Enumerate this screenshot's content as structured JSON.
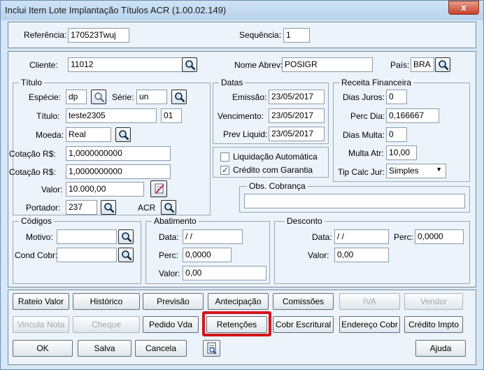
{
  "window": {
    "title": "Inclui Item Lote Implantação Títulos ACR (1.00.02.149)",
    "close_label": "x"
  },
  "header": {
    "referencia_label": "Referência:",
    "referencia_value": "170523Twuj",
    "sequencia_label": "Sequência:",
    "sequencia_value": "1"
  },
  "cliente": {
    "label": "Cliente:",
    "value": "11012",
    "nome_abrev_label": "Nome Abrev:",
    "nome_abrev_value": "POSIGR",
    "pais_label": "País:",
    "pais_value": "BRA"
  },
  "titulo": {
    "group_label": "Título",
    "especie_label": "Espécie:",
    "especie_value": "dp",
    "serie_label": "Série:",
    "serie_value": "un",
    "titulo_label": "Título:",
    "titulo_value": "teste2305",
    "parcela_value": "01",
    "moeda_label": "Moeda:",
    "moeda_value": "Real",
    "cotacao1_label": "Cotação R$:",
    "cotacao1_value": "1,0000000000",
    "cotacao2_label": "Cotação R$:",
    "cotacao2_value": "1,0000000000",
    "valor_label": "Valor:",
    "valor_value": "10.000,00",
    "portador_label": "Portador:",
    "portador_value": "237",
    "carteira_value": "ACR"
  },
  "datas": {
    "group_label": "Datas",
    "emissao_label": "Emissão:",
    "emissao_value": "23/05/2017",
    "vencimento_label": "Vencimento:",
    "vencimento_value": "23/05/2017",
    "prev_liquid_label": "Prev Liquid:",
    "prev_liquid_value": "23/05/2017"
  },
  "opcoes": {
    "liquidacao_label": "Liquidação Automática",
    "liquidacao_checked": false,
    "credito_label": "Crédito com Garantia",
    "credito_checked": true
  },
  "receita": {
    "group_label": "Receita Financeira",
    "dias_juros_label": "Dias Juros:",
    "dias_juros_value": "0",
    "perc_dia_label": "Perc Dia:",
    "perc_dia_value": "0,166667",
    "dias_multa_label": "Dias Multa:",
    "dias_multa_value": "0",
    "multa_atr_label": "Multa Atr:",
    "multa_atr_value": "10,00",
    "tip_calc_label": "Tip Calc Jur:",
    "tip_calc_value": "Simples"
  },
  "obs": {
    "group_label": "Obs. Cobrança",
    "value": ""
  },
  "codigos": {
    "group_label": "Códigos",
    "motivo_label": "Motivo:",
    "motivo_value": "",
    "cond_cobr_label": "Cond Cobr:",
    "cond_cobr_value": ""
  },
  "abatimento": {
    "group_label": "Abatimento",
    "data_label": "Data:",
    "data_value": " / /",
    "perc_label": "Perc:",
    "perc_value": "0,0000",
    "valor_label": "Valor:",
    "valor_value": "0,00"
  },
  "desconto": {
    "group_label": "Desconto",
    "data_label": "Data:",
    "data_value": " / /",
    "perc_label": "Perc:",
    "perc_value": "0,0000",
    "valor_label": "Valor:",
    "valor_value": "0,00"
  },
  "buttons_row1": [
    "Rateio Valor",
    "Histórico",
    "Previsão",
    "Antecipação",
    "Comissões",
    "IVA",
    "Vendor"
  ],
  "buttons_row2": [
    "Vincula Nota",
    "Cheque",
    "Pedido Vda",
    "Retenções",
    "Cobr Escritural",
    "Endereço Cobr",
    "Crédito Impto"
  ],
  "footer": {
    "ok": "OK",
    "salva": "Salva",
    "cancela": "Cancela",
    "ajuda": "Ajuda"
  },
  "colors": {
    "highlight": "#d4141b",
    "window_bg": "#d6e7f5",
    "panel_bg": "#ecf3fa"
  }
}
